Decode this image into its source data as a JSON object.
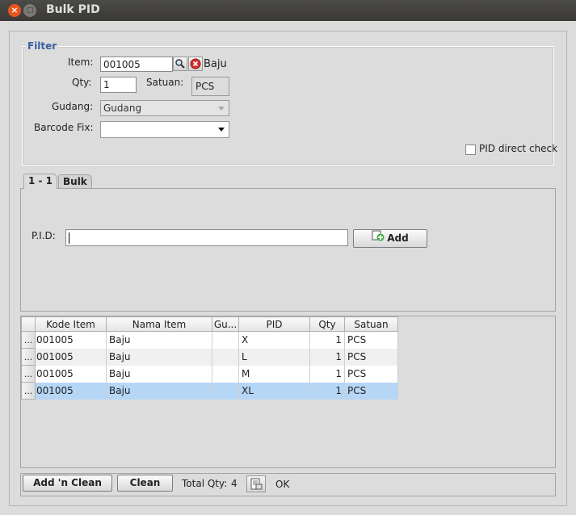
{
  "window": {
    "title": "Bulk PID",
    "close_glyph": "×",
    "max_glyph": "□"
  },
  "filter": {
    "legend": "Filter",
    "item_label": "Item:",
    "item_value": "001005",
    "item_name": "Baju",
    "qty_label": "Qty:",
    "qty_value": "1",
    "satuan_label": "Satuan:",
    "satuan_value": "PCS",
    "gudang_label": "Gudang:",
    "gudang_value": "Gudang",
    "barcode_label": "Barcode Fix:",
    "barcode_value": "",
    "pid_direct_label": "PID direct check",
    "pid_direct_checked": false
  },
  "tabs": [
    {
      "label": "1 - 1",
      "active": true
    },
    {
      "label": "Bulk",
      "active": false
    }
  ],
  "pid_entry": {
    "label": "P.I.D:",
    "value": "",
    "add_label": "Add"
  },
  "table": {
    "columns": [
      "Kode Item",
      "Nama Item",
      "Gu...",
      "PID",
      "Qty",
      "Satuan"
    ],
    "row_header": "...",
    "rows": [
      {
        "kode": "001005",
        "nama": "Baju",
        "gudang": "",
        "pid": "X",
        "qty": "1",
        "satuan": "PCS"
      },
      {
        "kode": "001005",
        "nama": "Baju",
        "gudang": "",
        "pid": "L",
        "qty": "1",
        "satuan": "PCS"
      },
      {
        "kode": "001005",
        "nama": "Baju",
        "gudang": "",
        "pid": "M",
        "qty": "1",
        "satuan": "PCS"
      },
      {
        "kode": "001005",
        "nama": "Baju",
        "gudang": "",
        "pid": "XL",
        "qty": "1",
        "satuan": "PCS"
      }
    ],
    "selected_row": 3
  },
  "bottom": {
    "add_clean_label": "Add 'n Clean",
    "clean_label": "Clean",
    "total_qty_label": "Total Qty:",
    "total_qty_value": "4",
    "status_text": "OK"
  },
  "colors": {
    "accent": "#3a5f9e",
    "selection": "#b6d6f6",
    "close_button": "#e9541f"
  },
  "icons": [
    "close-icon",
    "maximize-icon",
    "search-icon",
    "clear-icon",
    "add-icon",
    "export-icon"
  ]
}
